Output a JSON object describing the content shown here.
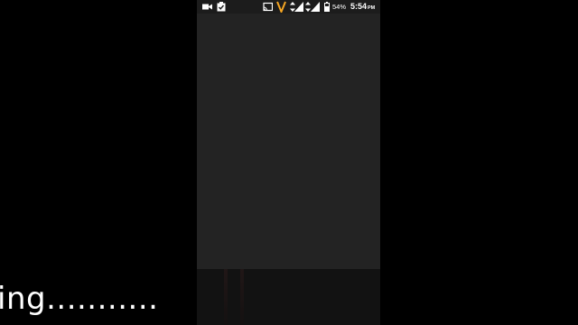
{
  "status_bar": {
    "left_icons": [
      "video-camera-icon",
      "clipboard-check-icon"
    ],
    "right_icons": [
      "cast-icon",
      "vodafone-v-icon",
      "data-arrows-icon",
      "signal-icon",
      "battery-icon"
    ],
    "battery_percent": "54%",
    "time": "5:54",
    "ampm": "PM",
    "accent_color": "#f5a623"
  },
  "caption": {
    "text": "ing..........."
  }
}
